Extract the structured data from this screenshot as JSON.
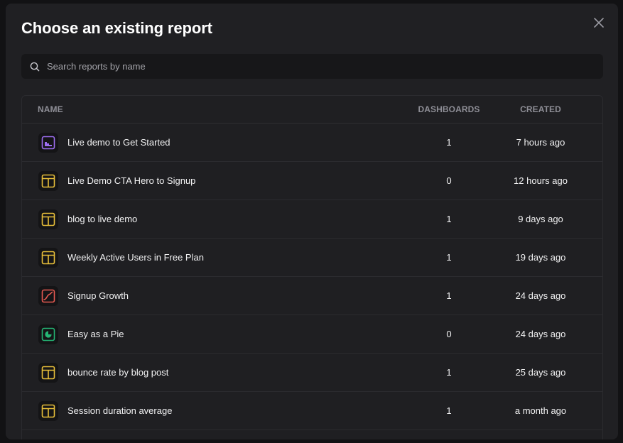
{
  "colors": {
    "table_icon": "#e8bf3a",
    "area_icon": "#9d6ef0",
    "line_icon": "#e85a52",
    "pie_icon": "#25b574"
  },
  "modal": {
    "title": "Choose an existing report",
    "close_icon": "close-icon"
  },
  "search": {
    "placeholder": "Search reports by name",
    "value": ""
  },
  "table": {
    "headers": {
      "name": "NAME",
      "dashboards": "DASHBOARDS",
      "created": "CREATED"
    },
    "rows": [
      {
        "icon": "area-chart-icon",
        "name": "Live demo to Get Started",
        "dashboards": "1",
        "created": "7 hours ago"
      },
      {
        "icon": "table-icon",
        "name": "Live Demo CTA Hero to Signup",
        "dashboards": "0",
        "created": "12 hours ago"
      },
      {
        "icon": "table-icon",
        "name": "blog to live demo",
        "dashboards": "1",
        "created": "9 days ago"
      },
      {
        "icon": "table-icon",
        "name": "Weekly Active Users in Free Plan",
        "dashboards": "1",
        "created": "19 days ago"
      },
      {
        "icon": "line-chart-icon",
        "name": "Signup Growth",
        "dashboards": "1",
        "created": "24 days ago"
      },
      {
        "icon": "pie-chart-icon",
        "name": "Easy as a Pie",
        "dashboards": "0",
        "created": "24 days ago"
      },
      {
        "icon": "table-icon",
        "name": "bounce rate by blog post",
        "dashboards": "1",
        "created": "25 days ago"
      },
      {
        "icon": "table-icon",
        "name": "Session duration average",
        "dashboards": "1",
        "created": "a month ago"
      }
    ]
  }
}
